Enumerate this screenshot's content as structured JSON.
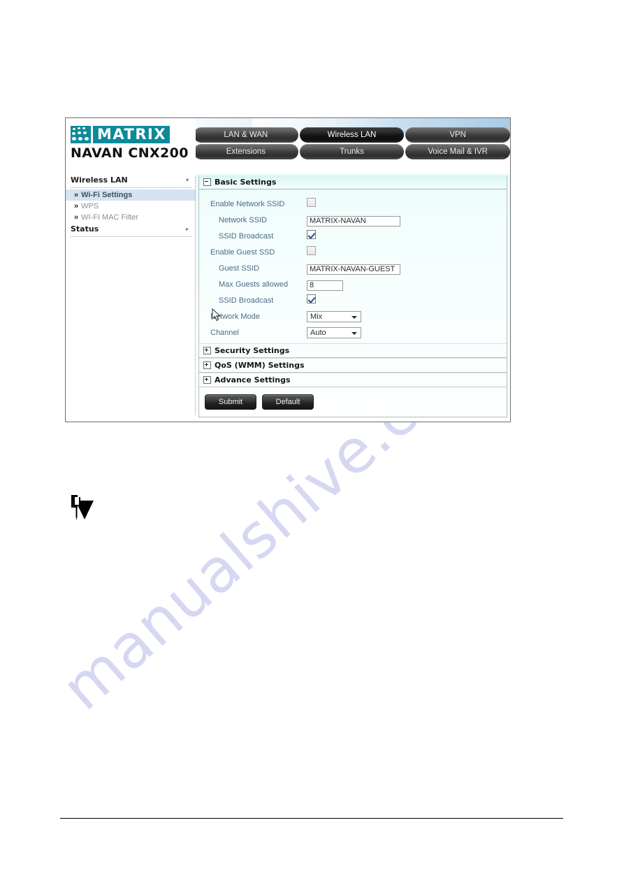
{
  "brand": {
    "logo_icon": "matrix-dots-logo",
    "logo_word": "MATRIX",
    "model": "NAVAN CNX200",
    "teal": "#0d8a99"
  },
  "tabs": {
    "row1": [
      {
        "label": "LAN & WAN",
        "active": false
      },
      {
        "label": "Wireless LAN",
        "active": true
      },
      {
        "label": "VPN",
        "active": false
      }
    ],
    "row2": [
      {
        "label": "Extensions",
        "active": false
      },
      {
        "label": "Trunks",
        "active": false
      },
      {
        "label": "Voice Mail & IVR",
        "active": false
      }
    ]
  },
  "sidebar": {
    "groups": [
      {
        "label": "Wireless LAN",
        "chevron": "▾",
        "items": [
          {
            "label": "Wi-Fi Settings",
            "selected": true
          },
          {
            "label": "WPS",
            "selected": false
          },
          {
            "label": "WI-FI MAC Filter",
            "selected": false
          }
        ]
      },
      {
        "label": "Status",
        "chevron": "▸",
        "items": []
      }
    ],
    "item_arrow": "»"
  },
  "main": {
    "sections": [
      {
        "title": "Basic Settings",
        "state": "expanded",
        "toggle_icon": "minus-box-icon"
      },
      {
        "title": "Security Settings",
        "state": "collapsed",
        "toggle_icon": "plus-box-icon"
      },
      {
        "title": "QoS (WMM) Settings",
        "state": "collapsed",
        "toggle_icon": "plus-box-icon"
      },
      {
        "title": "Advance Settings",
        "state": "collapsed",
        "toggle_icon": "plus-box-icon"
      }
    ],
    "fields": {
      "enable_network_ssid": {
        "label": "Enable Network SSID",
        "checked": false
      },
      "network_ssid": {
        "label": "Network SSID",
        "value": "MATRIX-NAVAN"
      },
      "ssid_broadcast_1": {
        "label": "SSID Broadcast",
        "checked": true
      },
      "enable_guest_ssid": {
        "label": "Enable Guest SSD",
        "checked": false
      },
      "guest_ssid": {
        "label": "Guest SSID",
        "value": "MATRIX-NAVAN-GUEST"
      },
      "max_guests": {
        "label": "Max Guests allowed",
        "value": "8"
      },
      "ssid_broadcast_2": {
        "label": "SSID Broadcast",
        "checked": true
      },
      "network_mode": {
        "label": "Network Mode",
        "value": "Mix"
      },
      "channel": {
        "label": "Channel",
        "value": "Auto"
      }
    },
    "buttons": {
      "submit": "Submit",
      "default": "Default"
    }
  },
  "note_icon": "note-pointer-icon",
  "watermark": "manualshive.com"
}
